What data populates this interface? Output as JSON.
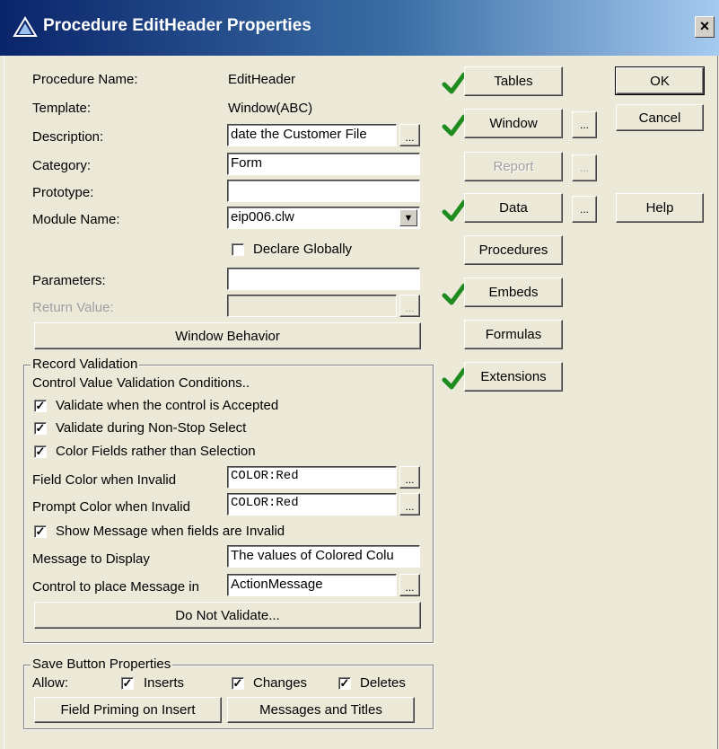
{
  "window": {
    "title": "Procedure EditHeader Properties",
    "close": "×"
  },
  "props": {
    "procedure_name_label": "Procedure Name:",
    "procedure_name_value": "EditHeader",
    "template_label": "Template:",
    "template_value": "Window(ABC)",
    "description_label": "Description:",
    "description_value": "date the Customer File",
    "category_label": "Category:",
    "category_value": "Form",
    "prototype_label": "Prototype:",
    "prototype_value": "",
    "module_label": "Module Name:",
    "module_value": "eip006.clw",
    "declare_globally": "Declare Globally",
    "parameters_label": "Parameters:",
    "parameters_value": "",
    "return_label": "Return Value:",
    "return_value": "",
    "window_behavior": "Window Behavior",
    "ellipsis": "..."
  },
  "right_buttons": {
    "tables": "Tables",
    "window": "Window",
    "report": "Report",
    "data": "Data",
    "procedures": "Procedures",
    "embeds": "Embeds",
    "formulas": "Formulas",
    "extensions": "Extensions",
    "ok": "OK",
    "cancel": "Cancel",
    "help": "Help"
  },
  "record_validation": {
    "title": "Record Validation",
    "subtitle": "Control Value Validation Conditions..",
    "chk_accepted": "Validate when the control is Accepted",
    "chk_nonstop": "Validate during Non-Stop Select",
    "chk_color": "Color Fields rather than Selection",
    "field_color_label": "Field Color when Invalid",
    "field_color_value": "COLOR:Red",
    "prompt_color_label": "Prompt Color when Invalid",
    "prompt_color_value": "COLOR:Red",
    "chk_show_message": "Show Message when fields are Invalid",
    "message_label": "Message to Display",
    "message_value": "The values of Colored Colu",
    "control_label": "Control to place Message in",
    "control_value": "ActionMessage",
    "do_not_validate": "Do Not Validate..."
  },
  "save_button": {
    "title": "Save Button Properties",
    "allow_label": "Allow:",
    "inserts": "Inserts",
    "changes": "Changes",
    "deletes": "Deletes",
    "field_priming": "Field Priming on Insert",
    "messages_titles": "Messages and Titles"
  },
  "check_mark": "✓",
  "colors": {
    "title_start": "#0A246A",
    "title_end": "#A6CAF0",
    "dialog_bg": "#ECE9D8",
    "tick_green": "#1E8C1E"
  }
}
